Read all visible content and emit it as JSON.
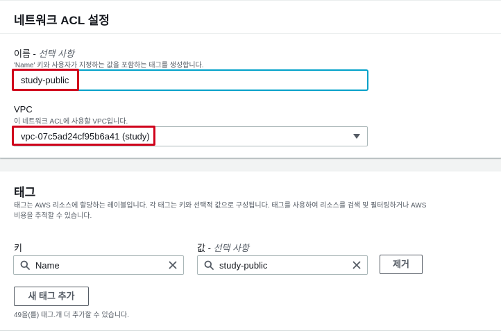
{
  "acl_settings": {
    "title": "네트워크 ACL 설정",
    "name": {
      "label": "이름 - ",
      "label_optional": "선택 사항",
      "description": "'Name' 키와 사용자가 지정하는 값을 포함하는 태그를 생성합니다.",
      "value": "study-public"
    },
    "vpc": {
      "label": "VPC",
      "description": "이 네트워크 ACL에 사용할 VPC입니다.",
      "selected": "vpc-07c5ad24cf95b6a41 (study)"
    }
  },
  "tags": {
    "title": "태그",
    "description_line1": "태그는 AWS 리소스에 할당하는 레이블입니다. 각 태그는 키와 선택적 값으로 구성됩니다. 태그를 사용하여 리소스를 검색 및 필터링하거나 AWS",
    "description_line2": "비용을 추적할 수 있습니다.",
    "key_label": "키",
    "value_label": "값 - ",
    "value_label_optional": "선택 사항",
    "rows": [
      {
        "key": "Name",
        "value": "study-public",
        "remove_label": "제거"
      }
    ],
    "add_button": "새 태그 추가",
    "remaining_note": "49을(를) 태그.개 더 추가할 수 있습니다."
  },
  "colors": {
    "highlight": "#d0021b",
    "focus": "#00a1c9"
  },
  "icons": [
    "search-icon",
    "clear-icon",
    "caret-down-icon"
  ]
}
